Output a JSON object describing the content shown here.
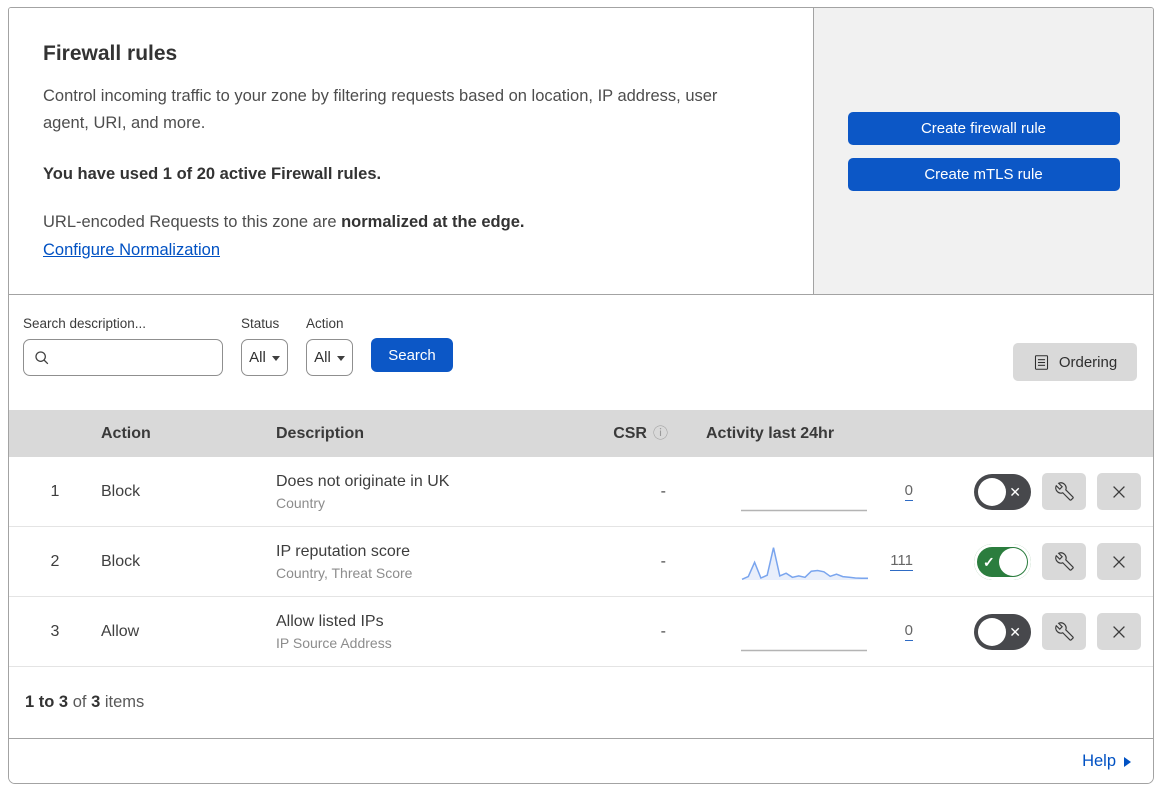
{
  "header": {
    "title": "Firewall rules",
    "description": "Control incoming traffic to your zone by filtering requests based on location, IP address, user agent, URI, and more.",
    "usage": "You have used 1 of 20 active Firewall rules.",
    "normalization_prefix": "URL-encoded Requests to this zone are ",
    "normalization_bold": "normalized at the edge.",
    "normalization_link": "Configure Normalization",
    "create_firewall_label": "Create firewall rule",
    "create_mtls_label": "Create mTLS rule"
  },
  "filters": {
    "search_label": "Search description...",
    "search_value": "",
    "status_label": "Status",
    "status_value": "All",
    "action_label": "Action",
    "action_value": "All",
    "search_button": "Search",
    "ordering_button": "Ordering"
  },
  "table": {
    "columns": {
      "action": "Action",
      "description": "Description",
      "csr": "CSR",
      "activity": "Activity last 24hr"
    },
    "rows": [
      {
        "index": "1",
        "action": "Block",
        "description": "Does not originate in UK",
        "fields": "Country",
        "csr": "-",
        "activity_count": "0",
        "enabled": false,
        "sparkline": []
      },
      {
        "index": "2",
        "action": "Block",
        "description": "IP reputation score",
        "fields": "Country, Threat Score",
        "csr": "-",
        "activity_count": "111",
        "enabled": true,
        "sparkline": [
          2,
          10,
          52,
          6,
          14,
          95,
          12,
          20,
          8,
          12,
          8,
          26,
          28,
          24,
          11,
          17,
          10,
          8,
          6,
          5,
          5
        ]
      },
      {
        "index": "3",
        "action": "Allow",
        "description": "Allow listed IPs",
        "fields": "IP Source Address",
        "csr": "-",
        "activity_count": "0",
        "enabled": false,
        "sparkline": []
      }
    ]
  },
  "footer": {
    "range": "1 to 3",
    "of_label": "of",
    "total": "3",
    "items_label": "items"
  },
  "help": {
    "label": "Help"
  },
  "icons": {
    "info": "ⓘ",
    "check": "✓",
    "x": "✕"
  },
  "colors": {
    "accent_blue": "#0c57c6",
    "link_blue": "#0051c3",
    "toggle_on_green": "#2b7d3e",
    "toggle_off_gray": "#47484c",
    "sparkline_line": "#7aa5ee",
    "sparkline_fill": "#e9effb",
    "flatline_gray": "#b4b4b4",
    "panel_gray": "#f1f1f1",
    "header_gray": "#d9d9d9"
  }
}
